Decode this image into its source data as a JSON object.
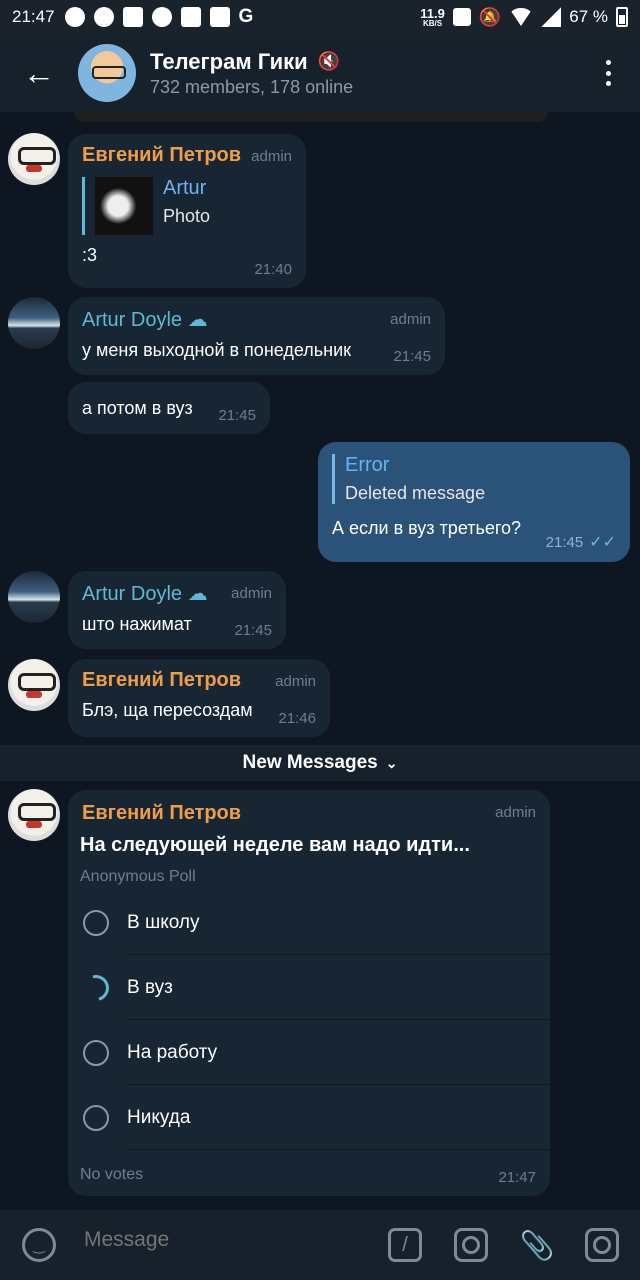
{
  "status_bar": {
    "time": "21:47",
    "speed_value": "11.9",
    "speed_unit": "KB/S",
    "battery": "67 %",
    "app_icons": [
      "telegram-icon",
      "telegram-plane-icon",
      "youtube-icon",
      "pinwheel-icon",
      "gmail-icon",
      "image-icon",
      "google-icon"
    ]
  },
  "header": {
    "title": "Телеграм Гики",
    "subtitle": "732 members, 178 online"
  },
  "messages": [
    {
      "sender": "Евгений Петров",
      "role": "admin",
      "reply_name": "Artur",
      "reply_body": "Photo",
      "text": ":3",
      "time": "21:40"
    },
    {
      "sender": "Artur Doyle",
      "role": "admin",
      "text": "у меня выходной в понедельник",
      "time": "21:45"
    },
    {
      "text": "а потом в вуз",
      "time": "21:45"
    },
    {
      "outgoing": true,
      "reply_name": "Error",
      "reply_body": "Deleted message",
      "text": "А если в вуз третьего?",
      "time": "21:45"
    },
    {
      "sender": "Artur Doyle",
      "role": "admin",
      "text": "што нажимат",
      "time": "21:45"
    },
    {
      "sender": "Евгений Петров",
      "role": "admin",
      "text": "Блэ, ща пересоздам",
      "time": "21:46"
    }
  ],
  "new_messages_label": "New Messages",
  "poll": {
    "sender": "Евгений Петров",
    "role": "admin",
    "question": "На следующей неделе вам надо идти...",
    "type": "Anonymous Poll",
    "options": [
      "В школу",
      "В вуз",
      "На работу",
      "Никуда"
    ],
    "votes": "No votes",
    "time": "21:47"
  },
  "composer": {
    "placeholder": "Message"
  },
  "colors": {
    "background": "#0e1621",
    "header": "#17212b",
    "incoming_bubble": "#182533",
    "outgoing_bubble": "#2b5278",
    "sender_orange": "#ee9e47",
    "sender_cyan": "#5fb8d6"
  }
}
